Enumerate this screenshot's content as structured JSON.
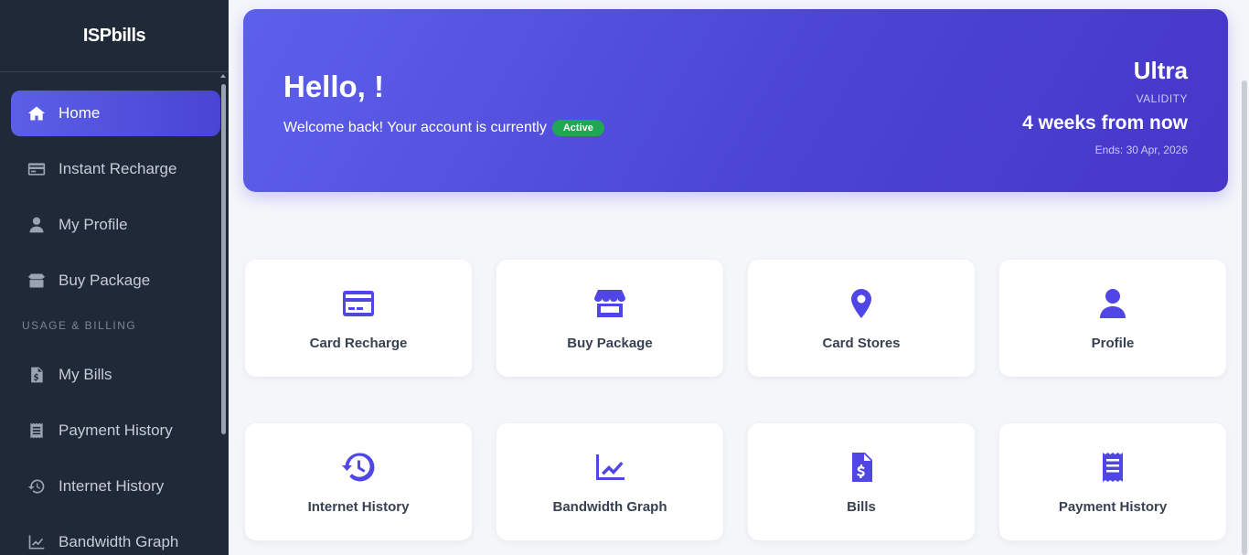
{
  "app": {
    "brand": "ISPbills"
  },
  "sidebar": {
    "items": [
      {
        "label": "Home",
        "icon": "home-icon"
      },
      {
        "label": "Instant Recharge",
        "icon": "credit-card-icon"
      },
      {
        "label": "My Profile",
        "icon": "user-icon"
      },
      {
        "label": "Buy Package",
        "icon": "box-icon"
      }
    ],
    "section_label": "USAGE & BILLING",
    "section_items": [
      {
        "label": "My Bills",
        "icon": "file-invoice-icon"
      },
      {
        "label": "Payment History",
        "icon": "receipt-icon"
      },
      {
        "label": "Internet History",
        "icon": "history-icon"
      },
      {
        "label": "Bandwidth Graph",
        "icon": "chart-line-icon"
      }
    ]
  },
  "hero": {
    "greeting": "Hello, !",
    "welcome": "Welcome back! Your account is currently",
    "status": "Active",
    "package": "Ultra",
    "validity_label": "VALIDITY",
    "validity_value": "4 weeks from now",
    "ends": "Ends: 30 Apr, 2026"
  },
  "cards": [
    {
      "label": "Card Recharge",
      "icon": "credit-card-icon"
    },
    {
      "label": "Buy Package",
      "icon": "store-icon"
    },
    {
      "label": "Card Stores",
      "icon": "map-pin-icon"
    },
    {
      "label": "Profile",
      "icon": "user-icon"
    },
    {
      "label": "Internet History",
      "icon": "history-icon"
    },
    {
      "label": "Bandwidth Graph",
      "icon": "chart-line-icon"
    },
    {
      "label": "Bills",
      "icon": "file-invoice-icon"
    },
    {
      "label": "Payment History",
      "icon": "receipt-icon"
    }
  ],
  "colors": {
    "sidebar_bg": "#1f2937",
    "accent": "#4f46e5",
    "status_green": "#1fa851",
    "page_bg": "#f4f6fa"
  }
}
